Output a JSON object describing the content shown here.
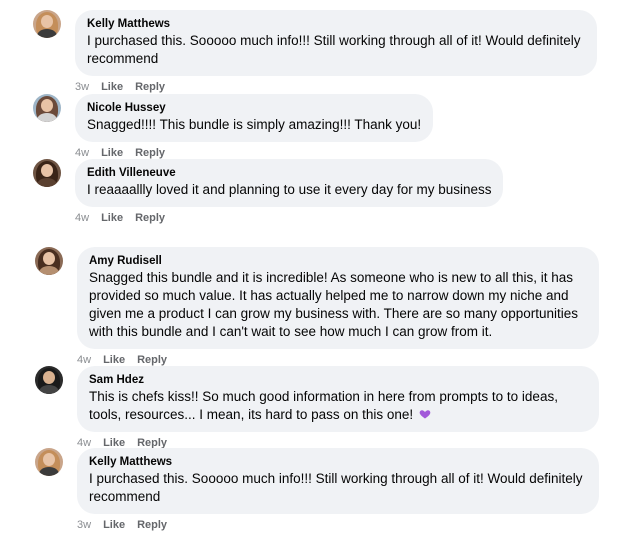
{
  "comments": [
    {
      "name": "Kelly Matthews",
      "text": "I purchased this. Sooooo much info!!! Still working through all of it! Would definitely recommend",
      "time": "3w",
      "like": "Like",
      "reply": "Reply"
    },
    {
      "name": "Nicole Hussey",
      "text": "Snagged!!!! This bundle is simply amazing!!! Thank you!",
      "time": "4w",
      "like": "Like",
      "reply": "Reply"
    },
    {
      "name": "Edith Villeneuve",
      "text": "I reaaaallly loved it and planning to use it every day for my business",
      "time": "4w",
      "like": "Like",
      "reply": "Reply"
    },
    {
      "name": "Amy Rudisell",
      "text": "Snagged this bundle and it is incredible! As someone who is new to all this, it has provided so much value. It has actually helped me to narrow down my niche and given me a product I can grow my business with. There are so many opportunities with this bundle and I can't wait to see how much I can grow from it.",
      "time": "4w",
      "like": "Like",
      "reply": "Reply"
    },
    {
      "name": "Sam Hdez",
      "text": "This is chefs kiss!! So much good information in here from prompts to to ideas, tools, resources... I mean, its hard to pass on this one!",
      "emoji": "purple-heart-icon",
      "time": "4w",
      "like": "Like",
      "reply": "Reply"
    },
    {
      "name": "Kelly Matthews",
      "text": "I purchased this. Sooooo much info!!! Still working through all of it! Would definitely recommend",
      "time": "3w",
      "like": "Like",
      "reply": "Reply"
    }
  ],
  "colors": {
    "bubble": "#f0f2f5",
    "action": "#65676b",
    "heart": "#a259d9"
  }
}
